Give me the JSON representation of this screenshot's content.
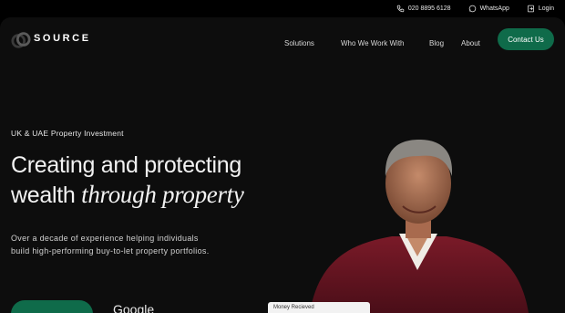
{
  "topbar": {
    "phone_icon": "phone-icon",
    "phone": "020 8895 6128",
    "whatsapp_icon": "whatsapp-icon",
    "whatsapp": "WhatsApp",
    "login_icon": "login-icon",
    "login": "Login"
  },
  "brand": {
    "name": "SOURCE",
    "logo_icon": "source-logo-mark",
    "accent": "#0f6b4a"
  },
  "nav": {
    "items": [
      {
        "label": "Solutions"
      },
      {
        "label": "Who We Work With"
      },
      {
        "label": "Blog"
      },
      {
        "label": "About"
      }
    ],
    "contact_label": "Contact Us"
  },
  "hero": {
    "kicker": "UK & UAE Property Investment",
    "headline_line1": "Creating and protecting",
    "headline_line2_plain": "wealth ",
    "headline_line2_italic": "through property",
    "description_line1": "Over a decade of experience helping individuals",
    "description_line2": "build high-performing buy-to-let property portfolios.",
    "google_label": "Google",
    "money_card_label": "Money Recieved"
  }
}
